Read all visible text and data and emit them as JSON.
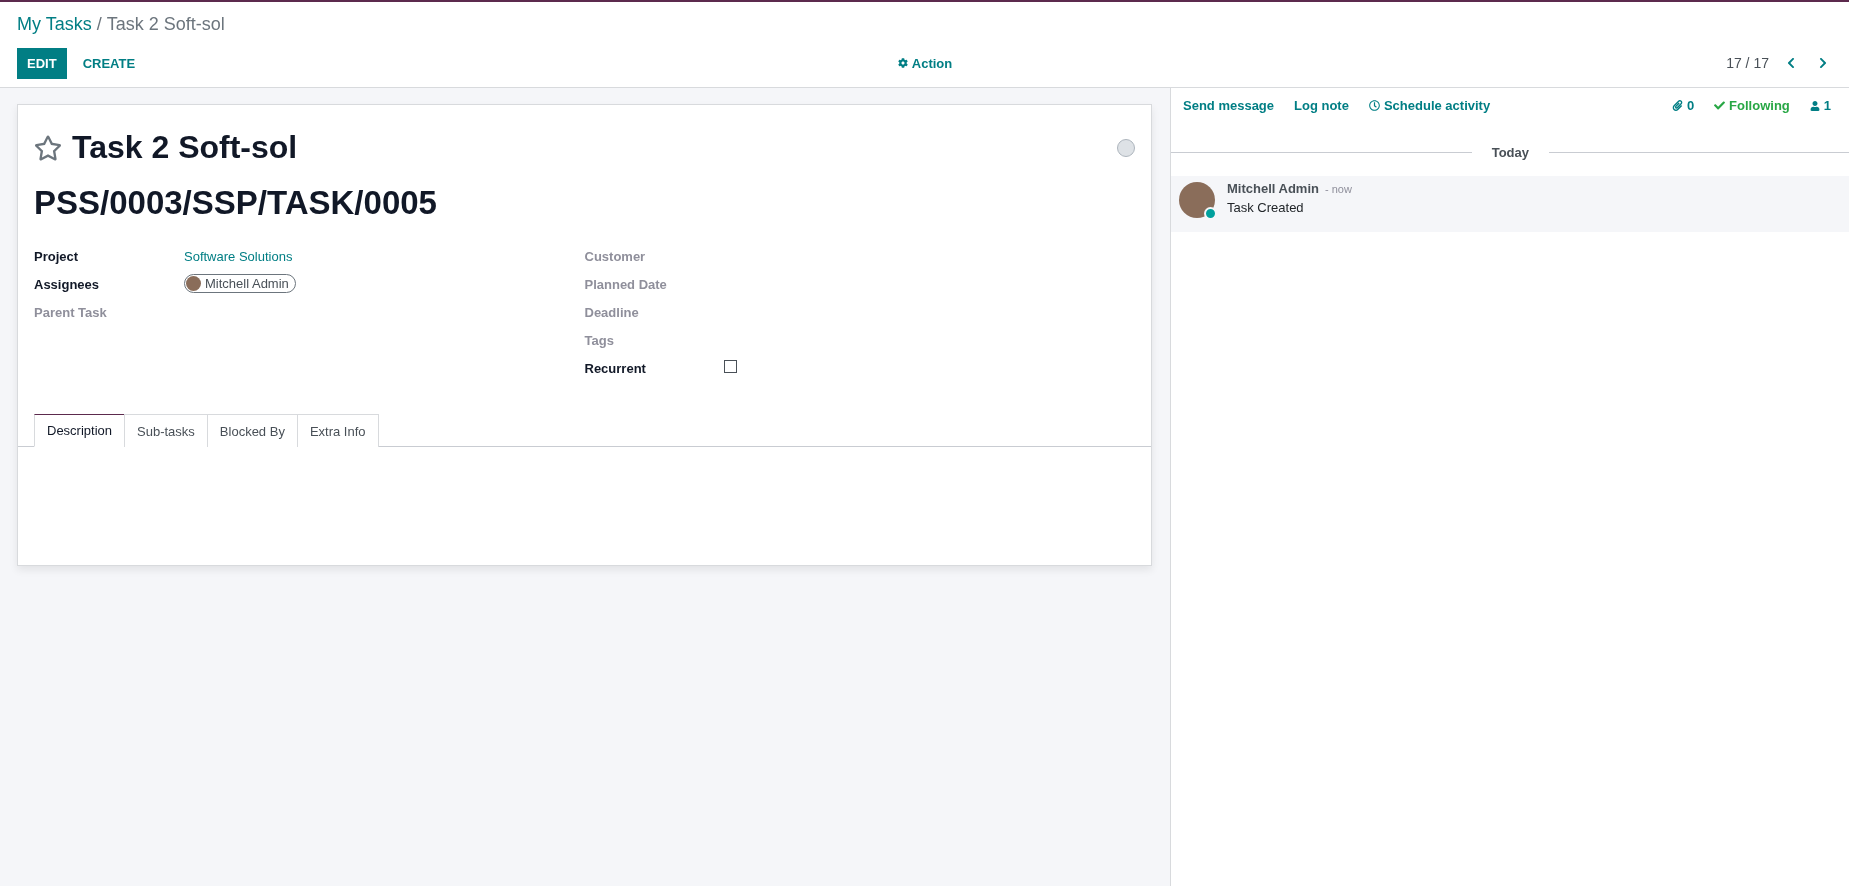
{
  "breadcrumb": {
    "parent": "My Tasks",
    "separator": "/",
    "current": "Task 2 Soft-sol"
  },
  "buttons": {
    "edit": "EDIT",
    "create": "CREATE",
    "action": "Action"
  },
  "pager": {
    "value": "17 / 17"
  },
  "task": {
    "starred": false,
    "name": "Task 2 Soft-sol",
    "status_done": false,
    "code": "PSS/0003/SSP/TASK/0005"
  },
  "left_fields": [
    {
      "label": "Project",
      "required": true,
      "kind": "link",
      "value": "Software Solutions"
    },
    {
      "label": "Assignees",
      "required": true,
      "kind": "tag",
      "value": "Mitchell Admin"
    },
    {
      "label": "Parent Task",
      "required": false,
      "kind": "empty"
    }
  ],
  "right_fields": [
    {
      "label": "Customer",
      "required": false,
      "kind": "empty"
    },
    {
      "label": "Planned Date",
      "required": false,
      "kind": "empty"
    },
    {
      "label": "Deadline",
      "required": false,
      "kind": "empty"
    },
    {
      "label": "Tags",
      "required": false,
      "kind": "empty"
    },
    {
      "label": "Recurrent",
      "required": true,
      "kind": "checkbox",
      "checked": false
    }
  ],
  "tabs": [
    {
      "label": "Description",
      "selected": true
    },
    {
      "label": "Sub-tasks",
      "selected": false
    },
    {
      "label": "Blocked By",
      "selected": false
    },
    {
      "label": "Extra Info",
      "selected": false
    }
  ],
  "chatter": {
    "send_message": "Send message",
    "log_note": "Log note",
    "schedule_activity": "Schedule activity",
    "attachments": "0",
    "following_label": "Following",
    "following": true,
    "followers": "1",
    "date_separator": "Today",
    "messages": [
      {
        "author": "Mitchell Admin",
        "time": "- now",
        "body": "Task Created",
        "online": true
      }
    ]
  }
}
